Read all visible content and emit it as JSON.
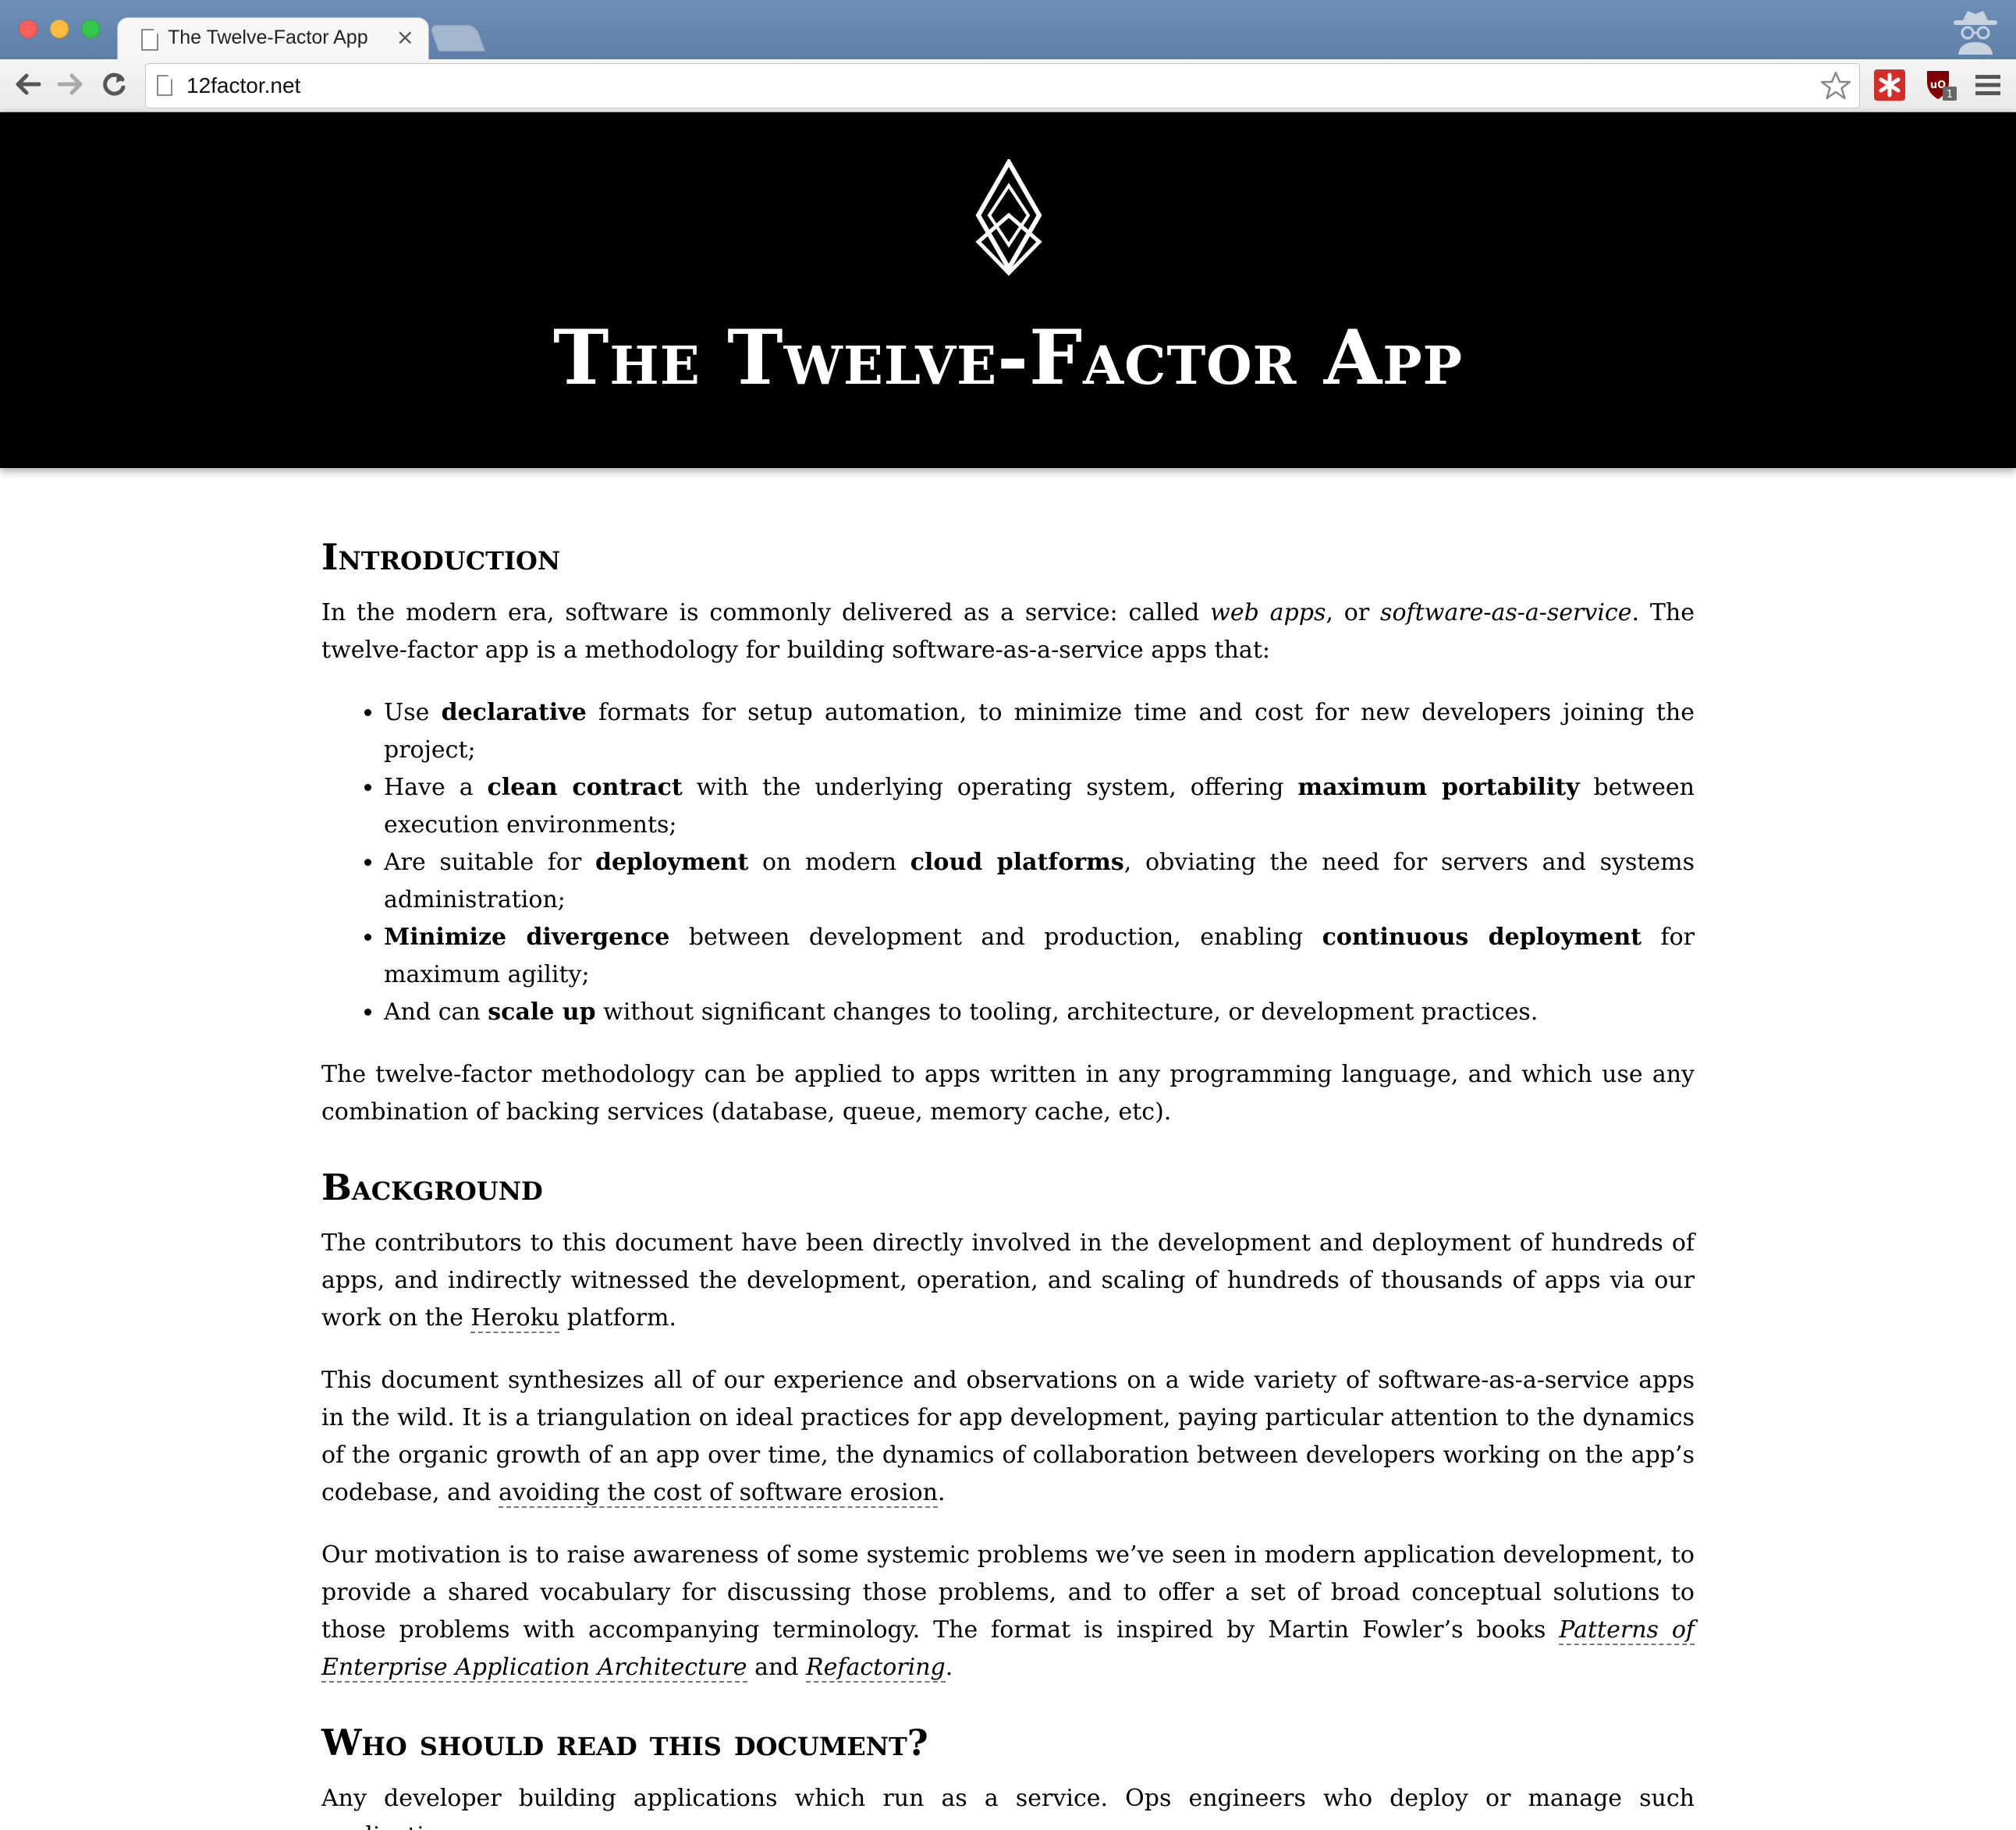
{
  "browser": {
    "tab_title": "The Twelve-Factor App",
    "tab_close": "×",
    "url": "12factor.net",
    "icons": [
      "back-icon",
      "forward-icon",
      "reload-icon",
      "page-icon",
      "bookmark-star-icon",
      "lastpass-icon",
      "ublock-icon",
      "menu-icon",
      "incognito-icon"
    ],
    "ublock_badge": "1"
  },
  "header": {
    "title": "The Twelve-Factor App"
  },
  "intro": {
    "heading": "Introduction",
    "p1": {
      "t1": "In the modern era, software is commonly delivered as a service: called ",
      "em1": "web apps",
      "t2": ", or ",
      "em2": "software-as-a-service",
      "t3": ". The twelve-factor app is a methodology for building software-as-a-service apps that:"
    },
    "bullets": [
      {
        "t1": "Use ",
        "b1": "declarative",
        "t2": " formats for setup automation, to minimize time and cost for new developers joining the project;"
      },
      {
        "t1": "Have a ",
        "b1": "clean contract",
        "t2": " with the underlying operating system, offering ",
        "b2": "maximum portability",
        "t3": " between execution environments;"
      },
      {
        "t1": "Are suitable for ",
        "b1": "deployment",
        "t2": " on modern ",
        "b2": "cloud platforms",
        "t3": ", obviating the need for servers and systems administration;"
      },
      {
        "b1": "Minimize divergence",
        "t1": " between development and production, enabling ",
        "b2": "continuous deployment",
        "t2": " for maximum agility;"
      },
      {
        "t1": "And can ",
        "b1": "scale up",
        "t2": " without significant changes to tooling, architecture, or development practices."
      }
    ],
    "p2": "The twelve-factor methodology can be applied to apps written in any programming language, and which use any combination of backing services (database, queue, memory cache, etc)."
  },
  "background": {
    "heading": "Background",
    "p1": {
      "t1": "The contributors to this document have been directly involved in the development and deployment of hundreds of apps, and indirectly witnessed the development, operation, and scaling of hundreds of thousands of apps via our work on the ",
      "link": "Heroku",
      "t2": " platform."
    },
    "p2": {
      "t1": "This document synthesizes all of our experience and observations on a wide variety of software-as-a-service apps in the wild. It is a triangulation on ideal practices for app development, paying particular attention to the dynamics of the organic growth of an app over time, the dynamics of collaboration between developers working on the app’s codebase, and ",
      "link": "avoiding the cost of software erosion",
      "t2": "."
    },
    "p3": {
      "t1": "Our motivation is to raise awareness of some systemic problems we’ve seen in modern application development, to provide a shared vocabulary for discussing those problems, and to offer a set of broad conceptual solutions to those problems with accompanying terminology. The format is inspired by Martin Fowler’s books ",
      "link1": "Patterns of Enterprise Application Architecture",
      "t2": " and ",
      "link2": "Refactoring",
      "t3": "."
    }
  },
  "who": {
    "heading": "Who should read this document?",
    "p1": "Any developer building applications which run as a service. Ops engineers who deploy or manage such applications."
  }
}
